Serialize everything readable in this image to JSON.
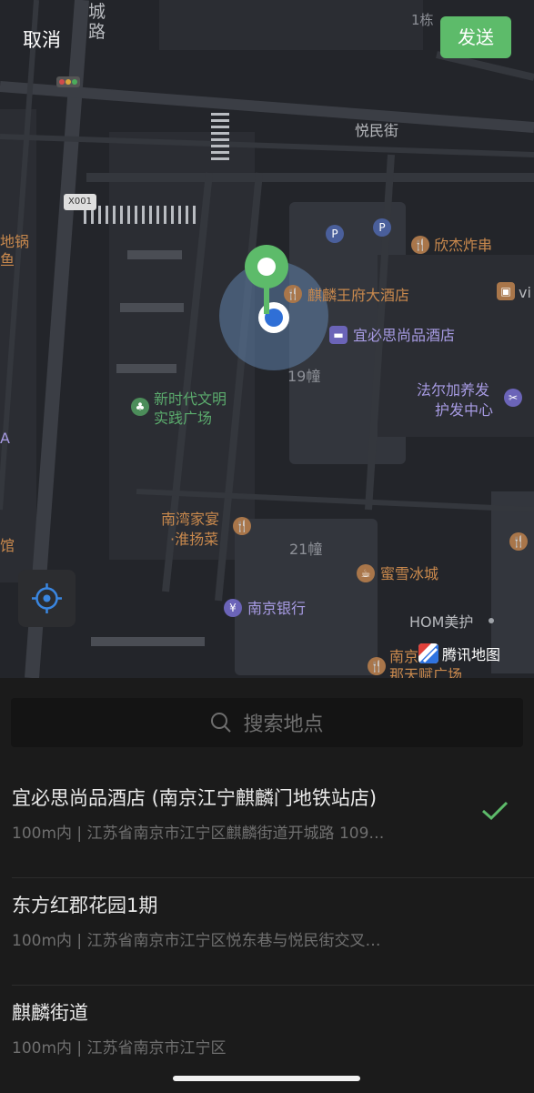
{
  "topbar": {
    "cancel_label": "取消",
    "send_label": "发送"
  },
  "map": {
    "roads": [
      {
        "name": "城路",
        "chars": [
          "城",
          "路"
        ]
      },
      {
        "name": "悦民街"
      },
      {
        "name": "1栋"
      }
    ],
    "road_badge": "X001",
    "building_labels": [
      "19幢",
      "21幢"
    ],
    "pois": [
      {
        "name": "欣杰炸串",
        "kind": "food"
      },
      {
        "name": "麒麟王府大酒店",
        "kind": "food"
      },
      {
        "name": "宜必思尚品酒店",
        "kind": "hotel"
      },
      {
        "name": "法尔加养发",
        "line2": "护发中心",
        "kind": "beauty"
      },
      {
        "name": "新时代文明",
        "line2": "实践广场",
        "kind": "park"
      },
      {
        "name": "南湾家宴",
        "line2": "·淮扬菜",
        "kind": "food"
      },
      {
        "name": "蜜雪冰城",
        "kind": "food"
      },
      {
        "name": "南京银行",
        "kind": "bank"
      },
      {
        "name": "HOM美护",
        "kind": "beauty"
      },
      {
        "name": "南京",
        "line2": "那天赋广场",
        "kind": "food"
      },
      {
        "name": "地锅",
        "line2": "鱼",
        "kind": "food"
      },
      {
        "name": "vi",
        "kind": "shop"
      },
      {
        "name": "A",
        "kind": "other"
      },
      {
        "name": "馆",
        "kind": "other"
      }
    ],
    "logo_text": "腾讯地图",
    "colors": {
      "pin": "#5dbb6a",
      "location_dot": "#2f6fd6",
      "accuracy_circle": "#5e7fa8"
    }
  },
  "search": {
    "placeholder": "搜索地点",
    "icon": "search-icon"
  },
  "results": [
    {
      "name": "宜必思尚品酒店 (南京江宁麒麟门地铁站店)",
      "address": "100m内 | 江苏省南京市江宁区麒麟街道开城路 109…",
      "selected": true
    },
    {
      "name": "东方红郡花园1期",
      "address": "100m内 | 江苏省南京市江宁区悦东巷与悦民街交叉…",
      "selected": false
    },
    {
      "name": "麒麟街道",
      "address": "100m内 | 江苏省南京市江宁区",
      "selected": false
    }
  ],
  "accent_color": "#5dbb6a"
}
